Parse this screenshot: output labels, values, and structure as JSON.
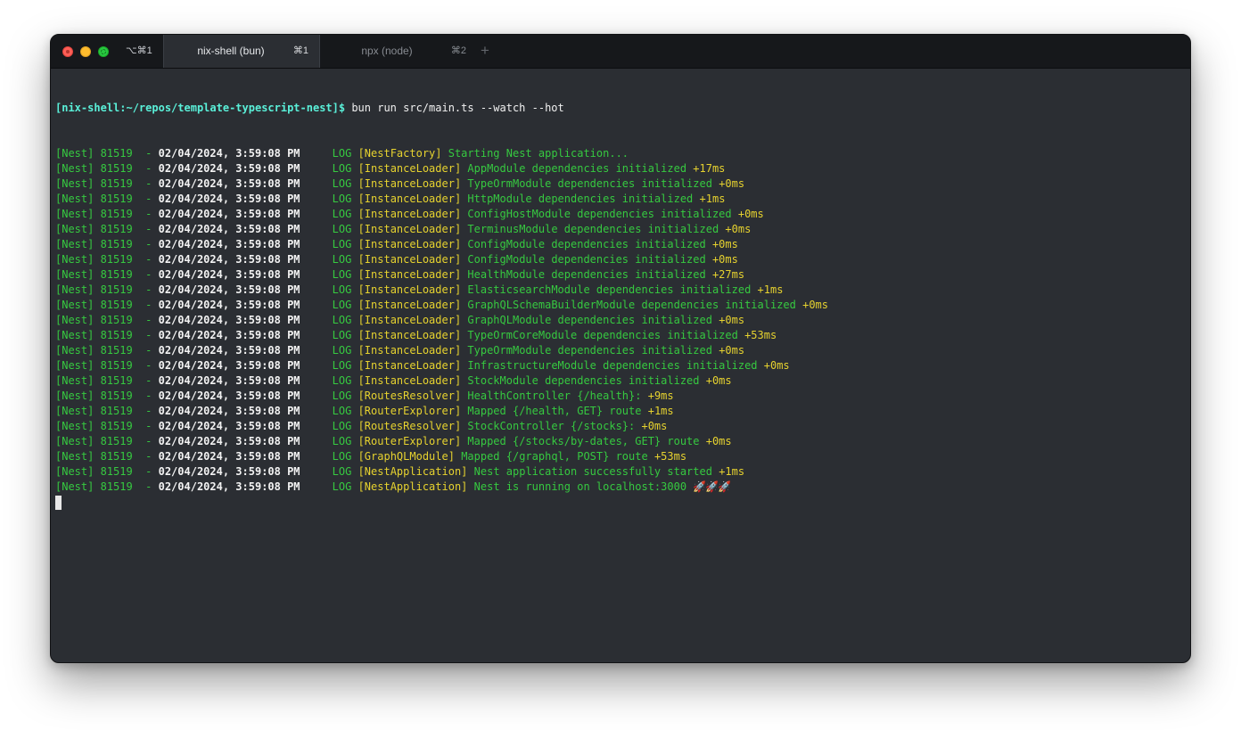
{
  "window": {
    "window_shortcut": "⌥⌘1",
    "tabs": [
      {
        "title": "nix-shell (bun)",
        "shortcut": "⌘1",
        "active": true
      },
      {
        "title": "npx (node)",
        "shortcut": "⌘2",
        "active": false
      }
    ],
    "new_tab_label": "+"
  },
  "colors": {
    "background": "#2b2e33",
    "green": "#36c940",
    "yellow": "#e6d22f",
    "prompt": "#5af0d9"
  },
  "terminal": {
    "prompt": "[nix-shell:~/repos/template-typescript-nest]$",
    "command": " bun run src/main.ts --watch --hot",
    "log_prefix": "[Nest] 81519  - ",
    "timestamp": "02/04/2024, 3:59:08 PM",
    "level": "     LOG ",
    "lines": [
      {
        "context": "[NestFactory]",
        "message": "Starting Nest application...",
        "elapsed": ""
      },
      {
        "context": "[InstanceLoader]",
        "message": "AppModule dependencies initialized",
        "elapsed": "+17ms"
      },
      {
        "context": "[InstanceLoader]",
        "message": "TypeOrmModule dependencies initialized",
        "elapsed": "+0ms"
      },
      {
        "context": "[InstanceLoader]",
        "message": "HttpModule dependencies initialized",
        "elapsed": "+1ms"
      },
      {
        "context": "[InstanceLoader]",
        "message": "ConfigHostModule dependencies initialized",
        "elapsed": "+0ms"
      },
      {
        "context": "[InstanceLoader]",
        "message": "TerminusModule dependencies initialized",
        "elapsed": "+0ms"
      },
      {
        "context": "[InstanceLoader]",
        "message": "ConfigModule dependencies initialized",
        "elapsed": "+0ms"
      },
      {
        "context": "[InstanceLoader]",
        "message": "ConfigModule dependencies initialized",
        "elapsed": "+0ms"
      },
      {
        "context": "[InstanceLoader]",
        "message": "HealthModule dependencies initialized",
        "elapsed": "+27ms"
      },
      {
        "context": "[InstanceLoader]",
        "message": "ElasticsearchModule dependencies initialized",
        "elapsed": "+1ms"
      },
      {
        "context": "[InstanceLoader]",
        "message": "GraphQLSchemaBuilderModule dependencies initialized",
        "elapsed": "+0ms"
      },
      {
        "context": "[InstanceLoader]",
        "message": "GraphQLModule dependencies initialized",
        "elapsed": "+0ms"
      },
      {
        "context": "[InstanceLoader]",
        "message": "TypeOrmCoreModule dependencies initialized",
        "elapsed": "+53ms"
      },
      {
        "context": "[InstanceLoader]",
        "message": "TypeOrmModule dependencies initialized",
        "elapsed": "+0ms"
      },
      {
        "context": "[InstanceLoader]",
        "message": "InfrastructureModule dependencies initialized",
        "elapsed": "+0ms"
      },
      {
        "context": "[InstanceLoader]",
        "message": "StockModule dependencies initialized",
        "elapsed": "+0ms"
      },
      {
        "context": "[RoutesResolver]",
        "message": "HealthController {/health}:",
        "elapsed": "+9ms"
      },
      {
        "context": "[RouterExplorer]",
        "message": "Mapped {/health, GET} route",
        "elapsed": "+1ms"
      },
      {
        "context": "[RoutesResolver]",
        "message": "StockController {/stocks}:",
        "elapsed": "+0ms"
      },
      {
        "context": "[RouterExplorer]",
        "message": "Mapped {/stocks/by-dates, GET} route",
        "elapsed": "+0ms"
      },
      {
        "context": "[GraphQLModule]",
        "message": "Mapped {/graphql, POST} route",
        "elapsed": "+53ms"
      },
      {
        "context": "[NestApplication]",
        "message": "Nest application successfully started",
        "elapsed": "+1ms"
      },
      {
        "context": "[NestApplication]",
        "message": "Nest is running on localhost:3000",
        "elapsed": "🚀🚀🚀"
      }
    ]
  }
}
